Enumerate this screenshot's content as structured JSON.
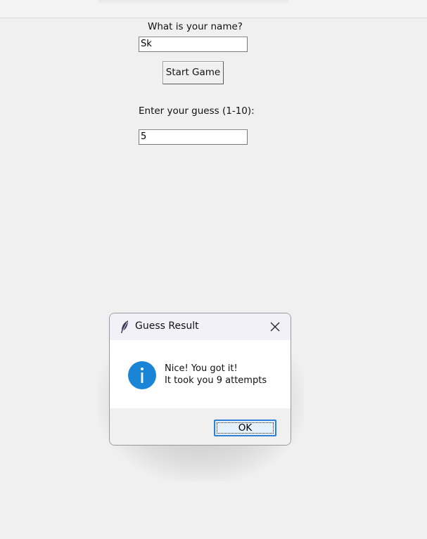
{
  "app": {
    "name_prompt": "What is your name?",
    "name_value": "Sk",
    "start_button_label": "Start Game",
    "guess_prompt": "Enter your guess (1-10):",
    "guess_value": "5"
  },
  "dialog": {
    "title": "Guess Result",
    "icon": "info-icon",
    "app_icon": "feather-icon",
    "message_line1": "Nice! You got it!",
    "message_line2": "It took you 9 attempts",
    "ok_label": "OK"
  },
  "colors": {
    "window_bg": "#f0f0f0",
    "info_icon": "#1a85d6",
    "ok_border": "#2f7fd4",
    "dialog_title_bg": "#f3f1f8"
  }
}
